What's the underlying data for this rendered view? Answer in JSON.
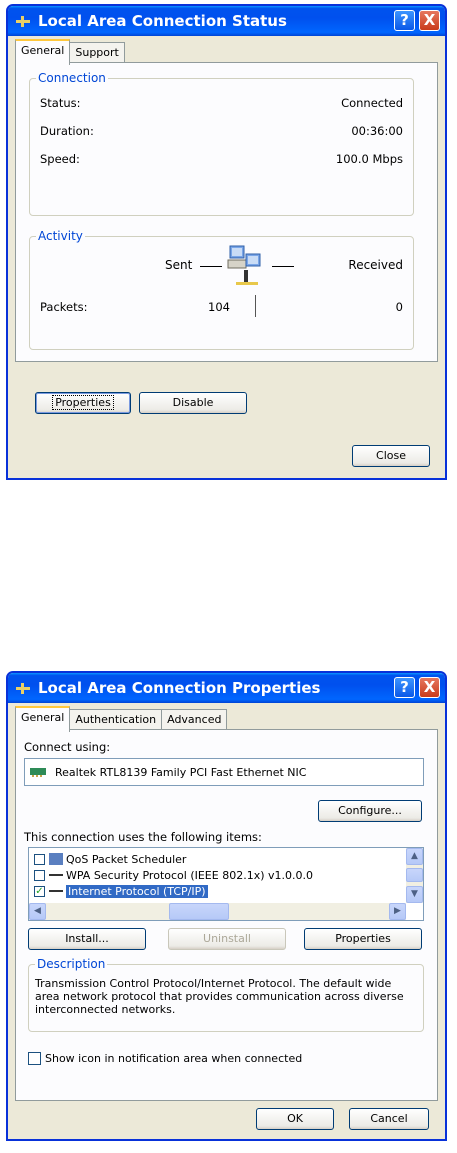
{
  "status_dialog": {
    "title": "Local Area Connection Status",
    "help_glyph": "?",
    "close_glyph": "X",
    "tabs": [
      {
        "label": "General",
        "active": true
      },
      {
        "label": "Support",
        "active": false
      }
    ],
    "connection": {
      "group_label": "Connection",
      "rows": [
        {
          "label": "Status:",
          "value": "Connected"
        },
        {
          "label": "Duration:",
          "value": "00:36:00"
        },
        {
          "label": "Speed:",
          "value": "100.0 Mbps"
        }
      ]
    },
    "activity": {
      "group_label": "Activity",
      "sent_label": "Sent",
      "received_label": "Received",
      "packets_label": "Packets:",
      "packets_sent": "104",
      "packets_received": "0"
    },
    "properties_button": "Properties",
    "disable_button": "Disable",
    "close_button": "Close"
  },
  "properties_dialog": {
    "title": "Local Area Connection Properties",
    "help_glyph": "?",
    "close_glyph": "X",
    "tabs": [
      {
        "label": "General",
        "active": true
      },
      {
        "label": "Authentication",
        "active": false
      },
      {
        "label": "Advanced",
        "active": false
      }
    ],
    "connect_using_label": "Connect using:",
    "adapter_name": "Realtek RTL8139 Family PCI Fast Ethernet NIC",
    "configure_button": "Configure...",
    "items_label": "This connection uses the following items:",
    "items": [
      {
        "label": "QoS Packet Scheduler",
        "checked": false,
        "selected": false
      },
      {
        "label": "WPA Security Protocol (IEEE 802.1x) v1.0.0.0",
        "checked": false,
        "selected": false
      },
      {
        "label": "Internet Protocol (TCP/IP)",
        "checked": true,
        "selected": true
      }
    ],
    "install_button": "Install...",
    "uninstall_button": "Uninstall",
    "properties_button": "Properties",
    "description_label": "Description",
    "description_text": "Transmission Control Protocol/Internet Protocol. The default wide area network protocol that provides communication across diverse interconnected networks.",
    "notify_label": "Show icon in notification area when connected",
    "notify_checked": false,
    "ok_button": "OK",
    "cancel_button": "Cancel"
  },
  "colors": {
    "titlebar": "#0055ea",
    "dialog_bg": "#ece9d8",
    "group_label": "#0046d5",
    "selection": "#316ac5"
  }
}
